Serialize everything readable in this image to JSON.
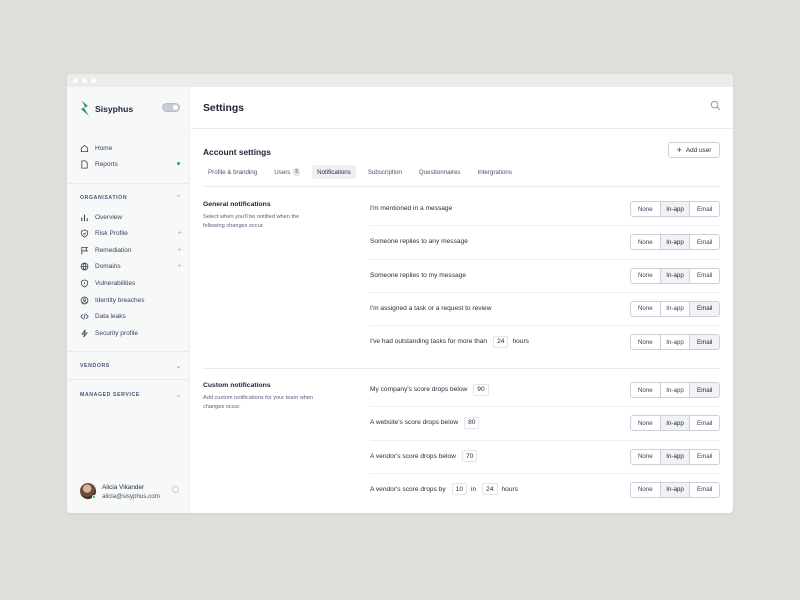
{
  "window": {
    "title": ""
  },
  "brand": {
    "name": "Sisyphus",
    "accent": "#1f9d67"
  },
  "sidebar": {
    "top_items": [
      {
        "label": "Home",
        "icon": "home-icon"
      },
      {
        "label": "Reports",
        "icon": "document-icon",
        "has_dot": true
      }
    ],
    "organisation": {
      "heading": "ORGANISATION",
      "items": [
        {
          "label": "Overview",
          "icon": "bar-chart-icon"
        },
        {
          "label": "Risk Profile",
          "icon": "shield-check-icon",
          "expandable": true
        },
        {
          "label": "Remediation",
          "icon": "flag-icon",
          "expandable": true
        },
        {
          "label": "Domains",
          "icon": "globe-icon",
          "expandable": true
        },
        {
          "label": "Vulnerabilities",
          "icon": "shield-alert-icon"
        },
        {
          "label": "Identity breaches",
          "icon": "user-circle-icon"
        },
        {
          "label": "Data leaks",
          "icon": "code-icon"
        },
        {
          "label": "Security profile",
          "icon": "bolt-icon"
        }
      ]
    },
    "vendors": {
      "heading": "VENDORS"
    },
    "managed_service": {
      "heading": "MANAGED SERVICE"
    },
    "user": {
      "name": "Alicia Vikander",
      "email": "alicia@sisyphus.com"
    }
  },
  "header": {
    "title": "Settings"
  },
  "account": {
    "title": "Account settings",
    "add_user_label": "Add user",
    "tabs": [
      {
        "label": "Profile & branding"
      },
      {
        "label": "Users",
        "badge": "5"
      },
      {
        "label": "Notifications",
        "active": true
      },
      {
        "label": "Subscription"
      },
      {
        "label": "Questionnaires"
      },
      {
        "label": "Intergrations"
      }
    ]
  },
  "options": [
    "None",
    "In-app",
    "Email"
  ],
  "general": {
    "title": "General notifications",
    "desc": "Select when you'll be notified when the following changes occur.",
    "rows": [
      {
        "text": "I'm mentioned in a message",
        "selected": "In-app"
      },
      {
        "text": "Someone replies to any message",
        "selected": "In-app"
      },
      {
        "text": "Someone replies to my message",
        "selected": "In-app"
      },
      {
        "text": "I'm assigned a task or a request to review",
        "selected": "Email"
      },
      {
        "text": "I've had outstanding tasks for more than",
        "value": "24",
        "suffix": "hours",
        "selected": "Email"
      }
    ]
  },
  "custom": {
    "title": "Custom notifications",
    "desc": "Add custom notifications for your team when changes occur.",
    "rows": [
      {
        "text": "My company's score drops below",
        "value": "90",
        "selected": "Email"
      },
      {
        "text": "A website's score drops below",
        "value": "80",
        "selected": "In-app"
      },
      {
        "text": "A vendor's score drops below",
        "value": "70",
        "selected": "In-app"
      },
      {
        "text": "A vendor's score drops by",
        "value": "10",
        "mid": "in",
        "value2": "24",
        "suffix": "hours",
        "selected": "In-app"
      }
    ]
  }
}
